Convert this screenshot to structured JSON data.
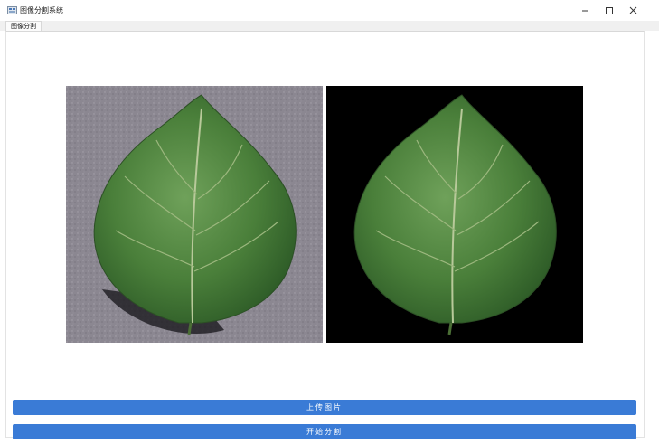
{
  "window": {
    "title": "图像分割系统",
    "controls": {
      "minimize": "–",
      "maximize": "□",
      "close": "✕"
    }
  },
  "tabs": [
    {
      "label": "图像分割",
      "active": true
    }
  ],
  "main": {
    "original_image": {
      "description_icon": "leaf-photo"
    },
    "segmented_image": {
      "description_icon": "leaf-segmented"
    },
    "upload_button": "上传图片",
    "segment_button": "开始分割"
  },
  "colors": {
    "button": "#3a7bd6",
    "button_text": "#ffffff",
    "leaf_green": "#4f8a3a",
    "segmented_background": "#000000"
  }
}
